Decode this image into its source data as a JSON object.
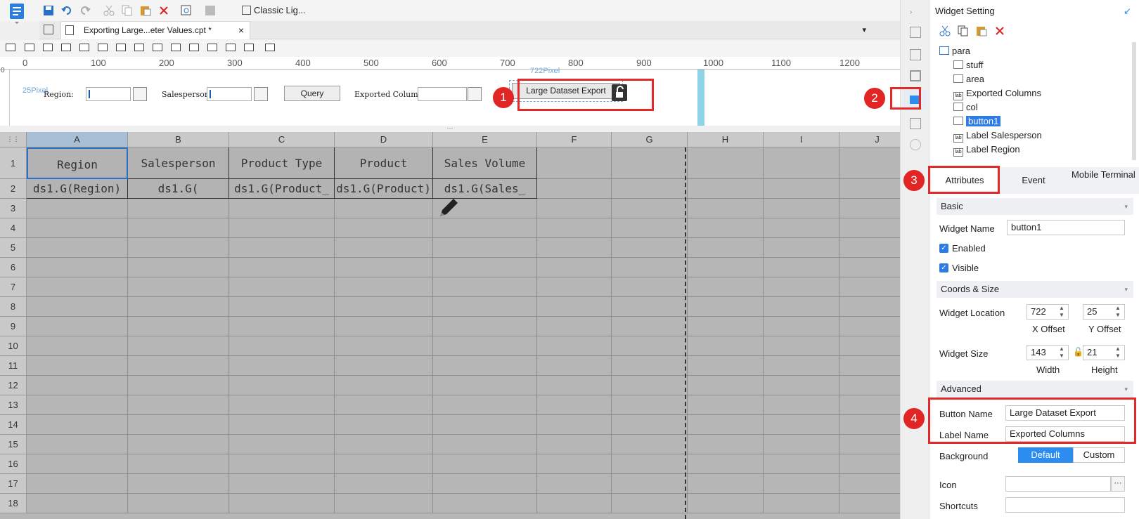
{
  "toolbar": {
    "theme_label": "Classic Lig..."
  },
  "tab": {
    "label": "Exporting Large...eter Values.cpt *"
  },
  "ruler": {
    "labels": [
      "0",
      "100",
      "200",
      "300",
      "400",
      "500",
      "600",
      "700",
      "800",
      "900",
      "1000",
      "1100",
      "1200"
    ]
  },
  "para": {
    "x_marker": "722Pixel",
    "y_marker": "25Pixel",
    "region_label": "Region:",
    "salesperson_label": "Salesperson:",
    "query_label": "Query",
    "exported_columns_label": "Exported Columns:",
    "export_button_label": "Large Dataset Export"
  },
  "badges": [
    "1",
    "2",
    "3",
    "4"
  ],
  "grid": {
    "columns": [
      "A",
      "B",
      "C",
      "D",
      "E",
      "F",
      "G",
      "H",
      "I",
      "J"
    ],
    "rows": [
      "1",
      "2",
      "3",
      "4",
      "5",
      "6",
      "7",
      "8",
      "9",
      "10",
      "11",
      "12",
      "13",
      "14",
      "15",
      "16",
      "17",
      "18"
    ],
    "headers": [
      "Region",
      "Salesperson",
      "Product Type",
      "Product",
      "Sales Volume"
    ],
    "formulas": [
      "ds1.G(Region)",
      "ds1.G(",
      "ds1.G(Product_",
      "ds1.G(Product)",
      "ds1.G(Sales_"
    ]
  },
  "panel": {
    "title": "Widget Setting",
    "tree": {
      "root": "para",
      "items": [
        "stuff",
        "area",
        "Exported Columns",
        "col",
        "button1",
        "Label Salesperson",
        "Label Region"
      ],
      "selected": "button1"
    },
    "tabs": {
      "attributes": "Attributes",
      "event": "Event",
      "mobile": "Mobile Terminal"
    },
    "basic": {
      "section": "Basic",
      "widget_name_label": "Widget Name",
      "widget_name_value": "button1",
      "enabled_label": "Enabled",
      "visible_label": "Visible"
    },
    "coords": {
      "section": "Coords & Size",
      "location_label": "Widget Location",
      "x_value": "722",
      "y_value": "25",
      "x_caption": "X Offset",
      "y_caption": "Y Offset",
      "size_label": "Widget Size",
      "width_value": "143",
      "height_value": "21",
      "width_caption": "Width",
      "height_caption": "Height"
    },
    "advanced": {
      "section": "Advanced",
      "button_name_label": "Button Name",
      "button_name_value": "Large Dataset Export",
      "label_name_label": "Label Name",
      "label_name_value": "Exported Columns",
      "background_label": "Background",
      "default_label": "Default",
      "custom_label": "Custom",
      "icon_label": "Icon",
      "icon_more": "···",
      "shortcuts_label": "Shortcuts"
    }
  },
  "colors": {
    "accent": "#2d8cf0",
    "highlight": "#e32a2a",
    "selection": "#2d7be5"
  }
}
